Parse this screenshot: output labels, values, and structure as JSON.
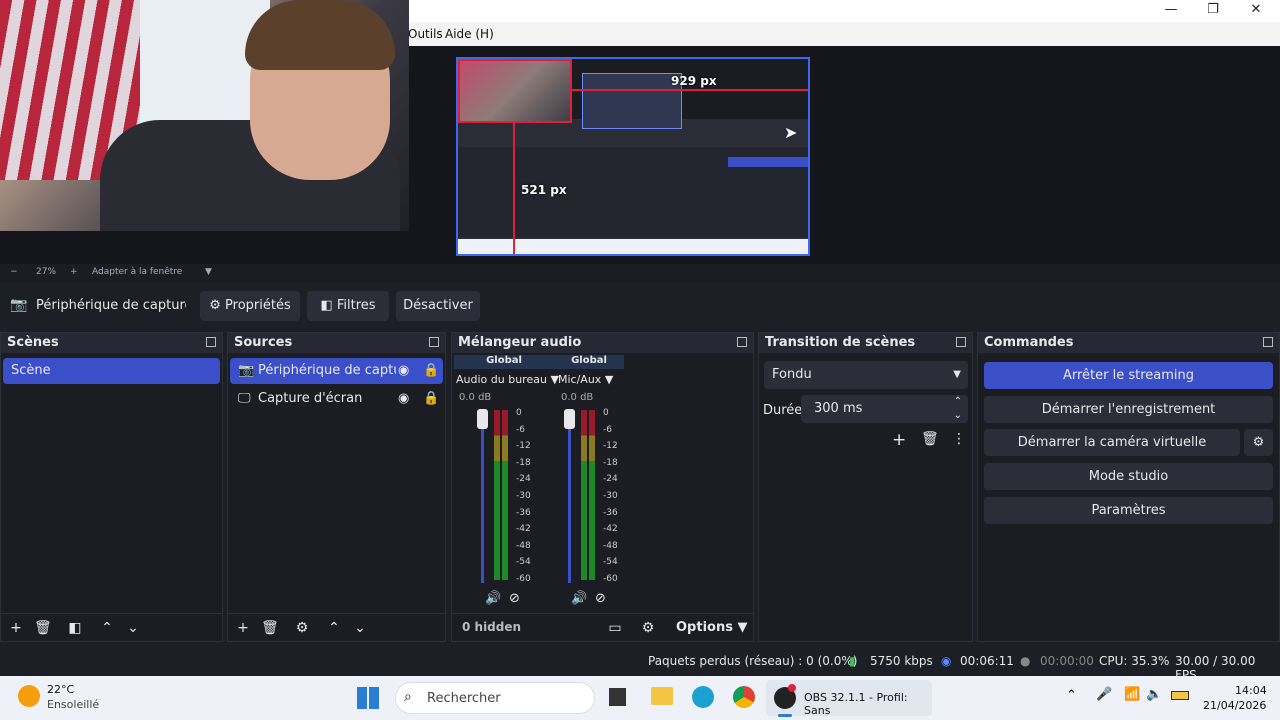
{
  "menubar": {
    "items": [
      "Outils",
      "Aide (H)"
    ]
  },
  "window_controls": {
    "minimize": "—",
    "maximize": "❐",
    "close": "✕"
  },
  "preview": {
    "width_label": "929 px",
    "height_label": "521 px"
  },
  "zoom": {
    "minus": "−",
    "level": "27%",
    "plus": "+",
    "fit": "Adapter à la fenêtre"
  },
  "source_toolbar": {
    "source_name": "Périphérique de capture vid",
    "properties": "Propriétés",
    "filters": "Filtres",
    "deactivate": "Désactiver"
  },
  "scenes": {
    "title": "Scènes",
    "items": [
      "Scène"
    ]
  },
  "sources": {
    "title": "Sources",
    "items": [
      "Périphérique de capture",
      "Capture d'écran"
    ]
  },
  "mixer": {
    "title": "Mélangeur audio",
    "channels": [
      {
        "tag": "Global",
        "name": "Audio du bureau",
        "db": "0.0 dB"
      },
      {
        "tag": "Global",
        "name": "Mic/Aux",
        "db": "0.0 dB"
      }
    ],
    "scale": [
      "0",
      "-6",
      "-12",
      "-18",
      "-24",
      "-30",
      "-36",
      "-42",
      "-48",
      "-54",
      "-60"
    ],
    "hidden": "0 hidden",
    "options": "Options"
  },
  "transition": {
    "title": "Transition de scènes",
    "type": "Fondu",
    "duration_label": "Durée",
    "duration_value": "300 ms"
  },
  "commands": {
    "title": "Commandes",
    "stop_streaming": "Arrêter le streaming",
    "start_recording": "Démarrer l'enregistrement",
    "start_virtual_cam": "Démarrer la caméra virtuelle",
    "studio_mode": "Mode studio",
    "settings": "Paramètres"
  },
  "status": {
    "dropped": "Paquets perdus (réseau) : 0 (0.0%)",
    "bitrate": "5750 kbps",
    "stream_time": "00:06:11",
    "record_time": "00:00:00",
    "cpu": "CPU: 35.3%",
    "fps": "30.00 / 30.00 FPS"
  },
  "taskbar": {
    "weather_temp": "22°C",
    "weather_desc": "Ensoleillé",
    "search_placeholder": "Rechercher",
    "obs_label": "OBS 32.1.1 - Profil: Sans",
    "time": "14:04",
    "date": "21/04/2026"
  },
  "colors": {
    "accent": "#3b4fc9",
    "preview_border": "#3d6be8",
    "selection_red": "#e0203a"
  }
}
